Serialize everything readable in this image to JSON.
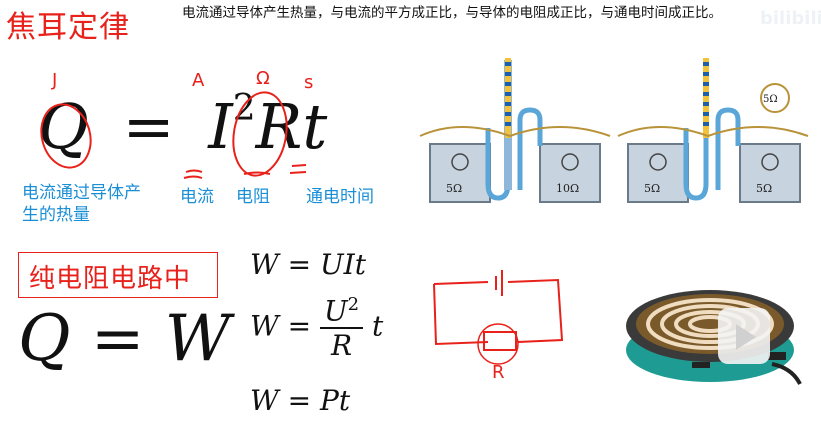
{
  "title": "焦耳定律",
  "description": "电流通过导体产生热量，与电流的平方成正比，与导体的电阻成正比，与通电时间成正比。",
  "watermark": "bilibili",
  "main_formula": {
    "q": "Q",
    "eq": "=",
    "i": "I",
    "exp": "2",
    "r": "R",
    "t": "t"
  },
  "unit_annotations": {
    "q": "J",
    "i": "A",
    "r": "Ω",
    "t": "s"
  },
  "term_labels": {
    "q": "电流通过导体产生的热量",
    "i": "电流",
    "r": "电阻",
    "t": "通电时间"
  },
  "pure_resistive_label": "纯电阻电路中",
  "qw_formula": "Q = W",
  "w_formulas": {
    "f1": "W = UIt",
    "f2_lhs": "W =",
    "f2_num": "U",
    "f2_exp": "2",
    "f2_den": "R",
    "f2_tail": "t",
    "f3": "W = Pt"
  },
  "apparatus_left": {
    "left_resistor": "5Ω",
    "right_resistor": "10Ω"
  },
  "apparatus_right": {
    "left_resistor": "5Ω",
    "right_resistor": "5Ω",
    "parallel_resistor": "5Ω"
  },
  "sketch_label": "R",
  "colors": {
    "title": "#e8211b",
    "label": "#1a8fd6",
    "ink": "#111111"
  }
}
